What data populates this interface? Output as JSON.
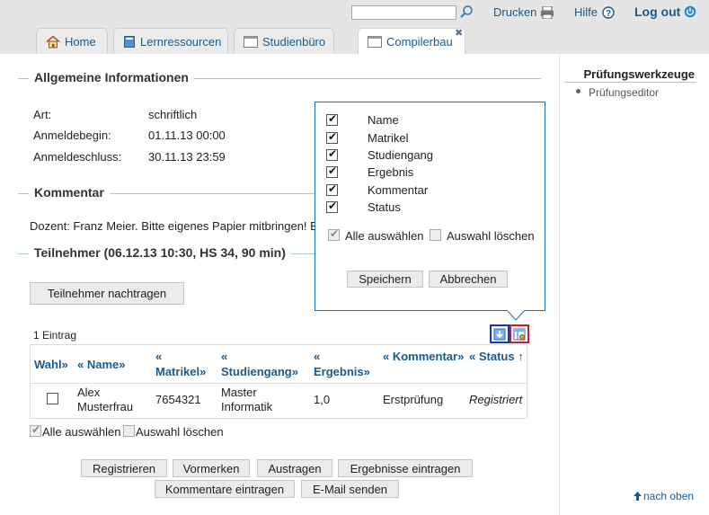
{
  "header": {
    "search_placeholder": "",
    "drucken": "Drucken",
    "hilfe": "Hilfe",
    "logout": "Log out"
  },
  "tabs": [
    {
      "label": "Home",
      "icon": "home-icon"
    },
    {
      "label": "Lernressourcen",
      "icon": "book-icon"
    },
    {
      "label": "Studienbüro",
      "icon": "window-icon"
    },
    {
      "label": "Compilerbau",
      "icon": "window-icon",
      "active": true
    }
  ],
  "info": {
    "title": "Allgemeine Informationen",
    "rows": [
      {
        "label": "Art:",
        "value": "schriftlich"
      },
      {
        "label": "Anmeldebegin:",
        "value": "01.11.13 00:00"
      },
      {
        "label": "Anmeldeschluss:",
        "value": "30.11.13 23:59"
      }
    ]
  },
  "kommentar": {
    "title": "Kommentar",
    "text": "Dozent: Franz Meier. Bitte eigenes Papier mitbringen! E"
  },
  "teilnehmer": {
    "title": "Teilnehmer (06.12.13 10:30, HS 34, 90 min)",
    "add_button": "Teilnehmer nachtragen",
    "count": "1 Eintrag",
    "columns": [
      "Wahl»",
      "« Name»",
      "« Matrikel»",
      "« Studiengang»",
      "« Ergebnis»",
      "« Kommentar»",
      "« Status ↑"
    ],
    "rows": [
      {
        "name_line1": "Alex",
        "name_line2": "Musterfrau",
        "matrikel": "7654321",
        "studiengang_line1": "Master",
        "studiengang_line2": "Informatik",
        "ergebnis": "1,0",
        "kommentar": "Erstprüfung",
        "status": "Registriert",
        "selected": false
      }
    ],
    "select_all": "Alle auswählen",
    "clear_selection": "Auswahl löschen",
    "actions_row1": [
      "Registrieren",
      "Vormerken",
      "Austragen",
      "Ergebnisse eintragen"
    ],
    "actions_row2": [
      "Kommentare eintragen",
      "E-Mail senden"
    ]
  },
  "column_popup": {
    "options": [
      {
        "label": "Name",
        "checked": true
      },
      {
        "label": "Matrikel",
        "checked": true
      },
      {
        "label": "Studiengang",
        "checked": true
      },
      {
        "label": "Ergebnis",
        "checked": true
      },
      {
        "label": "Kommentar",
        "checked": true
      },
      {
        "label": "Status",
        "checked": true
      }
    ],
    "select_all": "Alle auswählen",
    "clear_selection": "Auswahl löschen",
    "save": "Speichern",
    "cancel": "Abbrechen"
  },
  "sidebar": {
    "title": "Prüfungswerkzeuge",
    "items": [
      "Prüfungseditor"
    ],
    "back_to_top": "nach oben"
  },
  "colors": {
    "link": "#1a5a8c",
    "section_line": "#aac8dc",
    "popup_border": "#1f6fa6",
    "highlight_blue": "#1a2fd0",
    "highlight_red": "#d01a2a"
  }
}
